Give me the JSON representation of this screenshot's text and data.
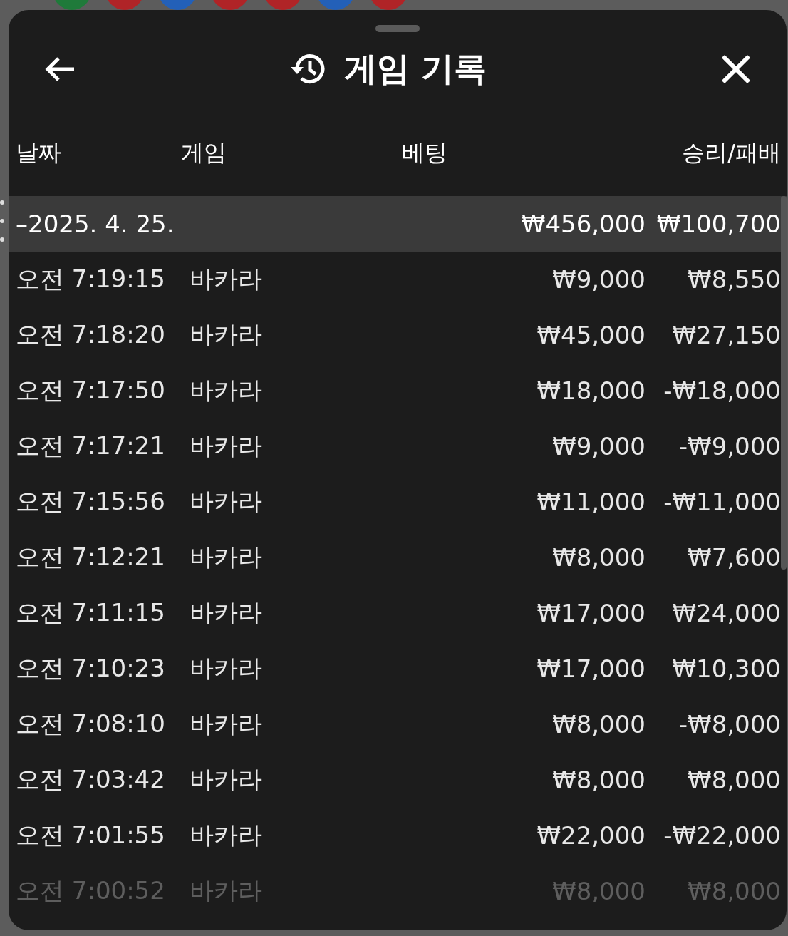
{
  "background_beads": [
    {
      "color": "#1f7a3a"
    },
    {
      "color": "#b02427"
    },
    {
      "color": "#2360b8"
    },
    {
      "color": "#b02427"
    },
    {
      "color": "#b02427"
    },
    {
      "color": "#2360b8"
    },
    {
      "color": "#b02427"
    }
  ],
  "sheet": {
    "title": "게임 기록"
  },
  "table": {
    "columns": [
      "날짜",
      "게임",
      "베팅",
      "승리/패배"
    ],
    "group": {
      "date": "–2025. 4. 25.",
      "bet_total": "₩456,000",
      "result_total": "₩100,700"
    },
    "rows": [
      {
        "time": "오전 7:19:15",
        "game": "바카라",
        "bet": "₩9,000",
        "result": "₩8,550",
        "faded": false
      },
      {
        "time": "오전 7:18:20",
        "game": "바카라",
        "bet": "₩45,000",
        "result": "₩27,150",
        "faded": false
      },
      {
        "time": "오전 7:17:50",
        "game": "바카라",
        "bet": "₩18,000",
        "result": "-₩18,000",
        "faded": false
      },
      {
        "time": "오전 7:17:21",
        "game": "바카라",
        "bet": "₩9,000",
        "result": "-₩9,000",
        "faded": false
      },
      {
        "time": "오전 7:15:56",
        "game": "바카라",
        "bet": "₩11,000",
        "result": "-₩11,000",
        "faded": false
      },
      {
        "time": "오전 7:12:21",
        "game": "바카라",
        "bet": "₩8,000",
        "result": "₩7,600",
        "faded": false
      },
      {
        "time": "오전 7:11:15",
        "game": "바카라",
        "bet": "₩17,000",
        "result": "₩24,000",
        "faded": false
      },
      {
        "time": "오전 7:10:23",
        "game": "바카라",
        "bet": "₩17,000",
        "result": "₩10,300",
        "faded": false
      },
      {
        "time": "오전 7:08:10",
        "game": "바카라",
        "bet": "₩8,000",
        "result": "-₩8,000",
        "faded": false
      },
      {
        "time": "오전 7:03:42",
        "game": "바카라",
        "bet": "₩8,000",
        "result": "₩8,000",
        "faded": false
      },
      {
        "time": "오전 7:01:55",
        "game": "바카라",
        "bet": "₩22,000",
        "result": "-₩22,000",
        "faded": false
      },
      {
        "time": "오전 7:00:52",
        "game": "바카라",
        "bet": "₩8,000",
        "result": "₩8,000",
        "faded": true
      }
    ]
  }
}
